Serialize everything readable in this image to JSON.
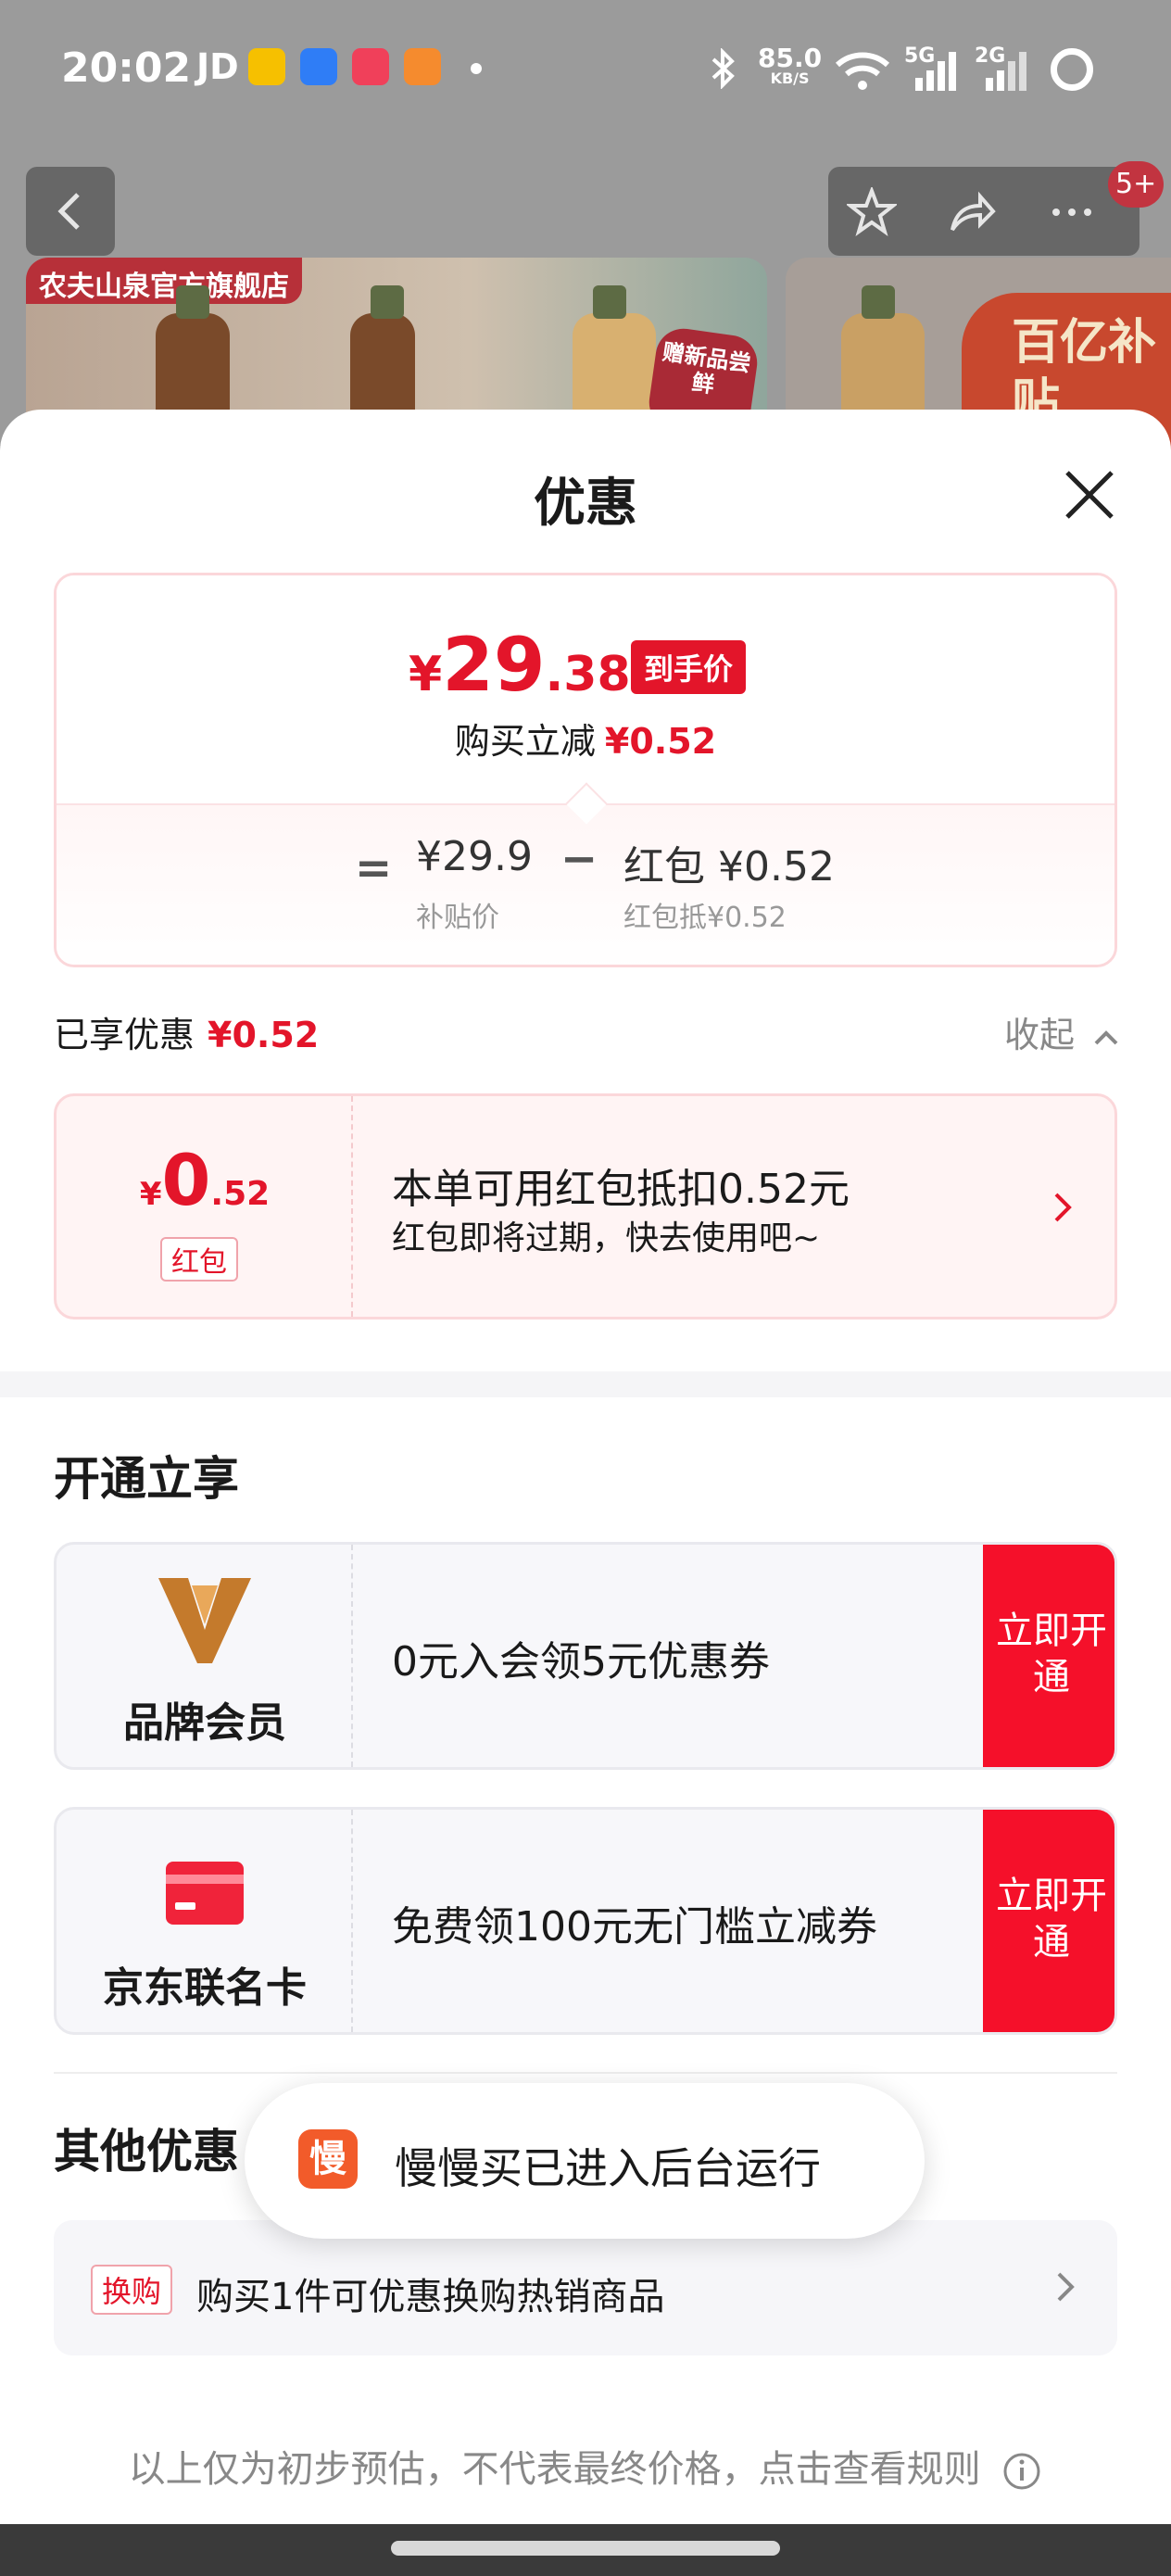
{
  "status_bar": {
    "time": "20:02",
    "carrier_text": "JD",
    "net_speed": "85.0",
    "net_speed_unit": "KB/S",
    "sim1": "5G",
    "sim2": "2G"
  },
  "background_page": {
    "store_tag": "农夫山泉官方旗舰店",
    "gift_badge": "赠新品尝鲜",
    "subsidy_sticker": "百亿补贴",
    "notification_badge": "5+"
  },
  "sheet": {
    "title": "优惠",
    "price_card": {
      "currency": "¥",
      "final_int": "29",
      "final_dec": ".38",
      "final_tag": "到手价",
      "reduce_label": "购买立减",
      "reduce_value": "¥0.52",
      "eq": "=",
      "base_price": "¥29.9",
      "base_price_label": "补贴价",
      "minus": "−",
      "coupon_value": "红包 ¥0.52",
      "coupon_label": "红包抵¥0.52"
    },
    "enjoyed": {
      "label": "已享优惠",
      "value": "¥0.52",
      "collapse_label": "收起"
    },
    "coupon": {
      "currency": "¥",
      "int": "0",
      "dec": ".52",
      "tag": "红包",
      "title": "本单可用红包抵扣0.52元",
      "subtitle": "红包即将过期，快去使用吧~"
    },
    "open_section": {
      "title": "开通立享",
      "items": [
        {
          "name": "品牌会员",
          "desc": "0元入会领5元优惠券",
          "button": "立即开通"
        },
        {
          "name": "京东联名卡",
          "desc": "免费领100元无门槛立减券",
          "button": "立即开通"
        }
      ]
    },
    "other_section": {
      "title": "其他优惠",
      "items": [
        {
          "tag": "换购",
          "text": "购买1件可优惠换购热销商品"
        }
      ]
    },
    "disclaimer": "以上仅为初步预估，不代表最终价格，点击查看规则"
  },
  "toast": {
    "icon_text": "慢",
    "message": "慢慢买已进入后台运行"
  },
  "colors": {
    "accent_red": "#e3152a",
    "button_red": "#f5102a",
    "brand_gold": "#c47a2c"
  }
}
